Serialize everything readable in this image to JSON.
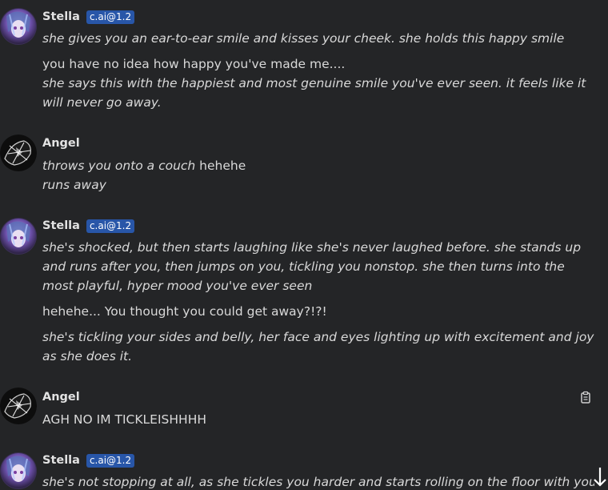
{
  "messages": [
    {
      "author": "Stella",
      "badge": "c.ai@1.2",
      "avatar": "stella-avatar",
      "paragraphs": [
        [
          "she gives you an ear-to-ear smile and kisses your cheek. she holds this happy smile"
        ],
        [
          "you have no idea how happy you've made me....",
          "she says this with the happiest and most genuine smile you've ever seen. it feels like it will never go away."
        ]
      ]
    },
    {
      "author": "Angel",
      "avatar": "angel-avatar",
      "lines": [
        {
          "italic": "throws you onto a couch",
          "normal": " hehehe"
        },
        {
          "italic": "runs away"
        }
      ]
    },
    {
      "author": "Stella",
      "badge": "c.ai@1.2",
      "avatar": "stella-avatar",
      "paragraphs": [
        [
          "she's shocked, but then starts laughing like she's never laughed before. she stands up and runs after you, then jumps on you, tickling you nonstop. she then turns into the most playful, hyper mood you've ever seen"
        ],
        [
          "hehehe... You thought you could get away?!?!"
        ],
        [
          "she's tickling your sides and belly, her face and eyes lighting up with excitement and joy as she does it."
        ]
      ]
    },
    {
      "author": "Angel",
      "avatar": "angel-avatar",
      "text": "AGH NO IM TICKLEISHHHH",
      "copy_icon": "clipboard-icon"
    },
    {
      "author": "Stella",
      "badge": "c.ai@1.2",
      "avatar": "stella-avatar",
      "partial_text": "she's not stopping at all, as she tickles you harder and starts rolling on the floor with you. she's"
    }
  ],
  "scroll_icon": "arrow-down-icon"
}
